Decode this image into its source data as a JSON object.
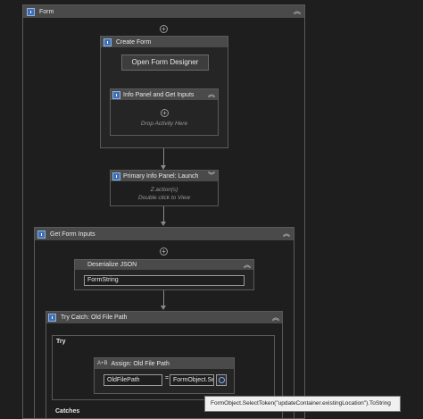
{
  "form": {
    "title": "Form",
    "collapse_icon": "chevron-double-up-icon"
  },
  "create_form": {
    "title": "Create Form",
    "button_label": "Open Form Designer"
  },
  "info_panel": {
    "title": "Info Panel and Get Inputs",
    "drop_hint": "Drop Activity Here"
  },
  "primary_panel": {
    "title": "Primary Info Panel: Launch",
    "hint_line1": "Z.action(s)",
    "hint_line2": "Double click to View"
  },
  "get_inputs": {
    "title": "Get Form Inputs"
  },
  "deserialize": {
    "title": "Deserialize JSON",
    "input_value": "FormString"
  },
  "try_catch": {
    "title": "Try Catch: Old File Path",
    "try_label": "Try",
    "catches_label": "Catches"
  },
  "assign": {
    "title": "Assign: Old File Path",
    "to_value": "OldFilePath",
    "equals": "=",
    "value_value": "FormObject.Se"
  },
  "tooltip": {
    "text": "FormObject.SelectToken(\"updateContainer.existingLocation\").ToString"
  },
  "colors": {
    "header": "#4a4a4a",
    "background": "#1e1e1e",
    "icon": "#3e6fb0"
  }
}
